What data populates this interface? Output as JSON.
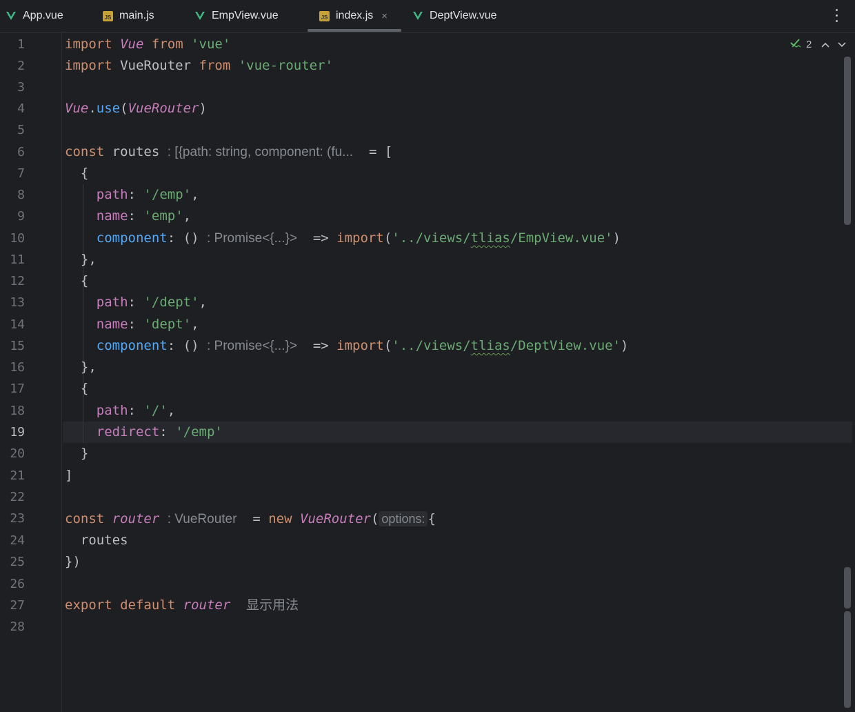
{
  "tabs": [
    {
      "label": "App.vue",
      "icon": "vue-icon",
      "active": false
    },
    {
      "label": "main.js",
      "icon": "js-icon",
      "active": false
    },
    {
      "label": "EmpView.vue",
      "icon": "vue-icon",
      "active": false
    },
    {
      "label": "index.js",
      "icon": "js-icon",
      "active": true,
      "close": "×"
    },
    {
      "label": "DeptView.vue",
      "icon": "vue-icon",
      "active": false
    }
  ],
  "inspection": {
    "count": "2"
  },
  "current_line": 19,
  "line_numbers": [
    "1",
    "2",
    "3",
    "4",
    "5",
    "6",
    "7",
    "8",
    "9",
    "10",
    "11",
    "12",
    "13",
    "14",
    "15",
    "16",
    "17",
    "18",
    "19",
    "20",
    "21",
    "22",
    "23",
    "24",
    "25",
    "26",
    "27",
    "28"
  ],
  "code": {
    "l1": {
      "t1": "import",
      "t2": "Vue",
      "t3": "from",
      "t4": "'vue'"
    },
    "l2": {
      "t1": "import",
      "t2": "VueRouter",
      "t3": "from",
      "t4": "'vue-router'"
    },
    "l4": {
      "t1": "Vue",
      "t2": ".",
      "t3": "use",
      "t4": "(",
      "t5": "VueRouter",
      "t6": ")"
    },
    "l6": {
      "t1": "const",
      "t2": "routes",
      "hint": ": [{path: string, component: (fu...",
      "t3": "= ["
    },
    "l7": {
      "t1": "{"
    },
    "l8": {
      "k": "path",
      "c": ":",
      "v": "'/emp'",
      "e": ","
    },
    "l9": {
      "k": "name",
      "c": ":",
      "v": "'emp'",
      "e": ","
    },
    "l10": {
      "k": "component",
      "c": ":",
      "p": "()",
      "hint": ": Promise<{...}>",
      "arrow": "=>",
      "imp": "import",
      "o": "(",
      "v1": "'../views/",
      "sq": "tlias",
      "v2": "/EmpView.vue'",
      "cl": ")"
    },
    "l11": {
      "t1": "},"
    },
    "l12": {
      "t1": "{"
    },
    "l13": {
      "k": "path",
      "c": ":",
      "v": "'/dept'",
      "e": ","
    },
    "l14": {
      "k": "name",
      "c": ":",
      "v": "'dept'",
      "e": ","
    },
    "l15": {
      "k": "component",
      "c": ":",
      "p": "()",
      "hint": ": Promise<{...}>",
      "arrow": "=>",
      "imp": "import",
      "o": "(",
      "v1": "'../views/",
      "sq": "tlias",
      "v2": "/DeptView.vue'",
      "cl": ")"
    },
    "l16": {
      "t1": "},"
    },
    "l17": {
      "t1": "{"
    },
    "l18": {
      "k": "path",
      "c": ":",
      "v": "'/'",
      "e": ","
    },
    "l19": {
      "k": "redirect",
      "c": ":",
      "v": "'/emp'"
    },
    "l20": {
      "t1": "}"
    },
    "l21": {
      "t1": "]"
    },
    "l23": {
      "t1": "const",
      "t2": "router",
      "hint": ": VueRouter",
      "t3": "=",
      "t4": "new",
      "t5": "VueRouter",
      "t6": "(",
      "hint2": "options:",
      "t7": "{"
    },
    "l24": {
      "t1": "routes"
    },
    "l25": {
      "t1": "})"
    },
    "l27": {
      "t1": "export",
      "t2": "default",
      "t3": "router",
      "hint": "显示用法"
    }
  },
  "colors": {
    "background": "#1e1f22",
    "keyword": "#cf8e6d",
    "string": "#6aab73",
    "property": "#c77dbb",
    "function": "#56a8f5",
    "hint": "#868a91"
  }
}
